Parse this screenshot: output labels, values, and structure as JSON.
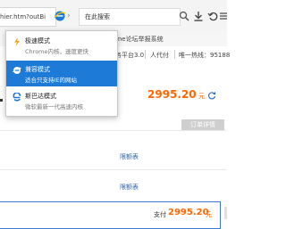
{
  "browser": {
    "url_fragment": "hier.htm?outBi",
    "search_placeholder": "在此搜索",
    "forward_glyph": "›"
  },
  "page": {
    "notice_fragment": "hrome论坛举报系统",
    "nav": [
      "服务平台3.0",
      "人代付",
      "唯一热线：95188"
    ],
    "price": "2995.20",
    "price_unit": "元",
    "order_detail_button": "订单详情",
    "limit_link_1": "限额表",
    "limit_link_2": "限额表",
    "pay_label": "支付",
    "pay_amount": "2995.20",
    "pay_unit": "元"
  },
  "mode_menu": {
    "items": [
      {
        "title": "极速模式",
        "subtitle": "Chrome内核，速度更快",
        "icon": "lightning-icon",
        "active": false
      },
      {
        "title": "兼容模式",
        "subtitle": "适合只支持IE的网站",
        "icon": "ie-icon",
        "active": true
      },
      {
        "title": "斯巴达模式",
        "subtitle": "微软最新一代高速内核",
        "icon": "spartan-e-icon",
        "active": false
      }
    ]
  },
  "colors": {
    "accent_blue": "#1e7ad7",
    "price_orange": "#ff6600",
    "link_blue": "#2a66b8",
    "lightning_orange": "#f5a623"
  }
}
